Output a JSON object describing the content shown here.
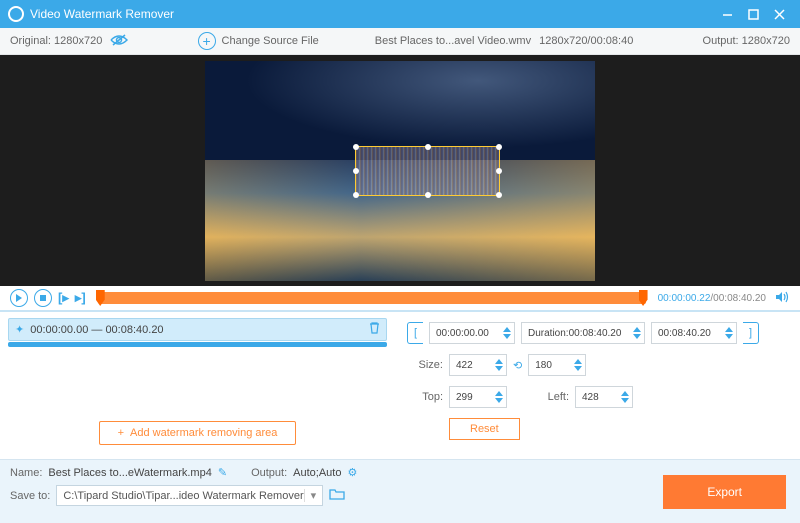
{
  "title": "Video Watermark Remover",
  "infobar": {
    "original": "Original: 1280x720",
    "change_source": "Change Source File",
    "filename": "Best Places to...avel Video.wmv",
    "resolution_duration": "1280x720/00:08:40",
    "output": "Output: 1280x720"
  },
  "playback": {
    "current": "00:00:00.22",
    "total": "/00:08:40.20"
  },
  "segment": {
    "range": "00:00:00.00 — 00:08:40.20"
  },
  "add_area": "Add watermark removing area",
  "params": {
    "start": "00:00:00.00",
    "duration_label": "Duration:",
    "duration": "00:08:40.20",
    "end": "00:08:40.20",
    "size_label": "Size:",
    "width": "422",
    "height": "180",
    "top_label": "Top:",
    "top": "299",
    "left_label": "Left:",
    "left": "428",
    "reset": "Reset"
  },
  "bottom": {
    "name_label": "Name:",
    "name": "Best Places to...eWatermark.mp4",
    "output_label": "Output:",
    "output": "Auto;Auto",
    "saveto_label": "Save to:",
    "path": "C:\\Tipard Studio\\Tipar...ideo Watermark Remover"
  },
  "export": "Export"
}
